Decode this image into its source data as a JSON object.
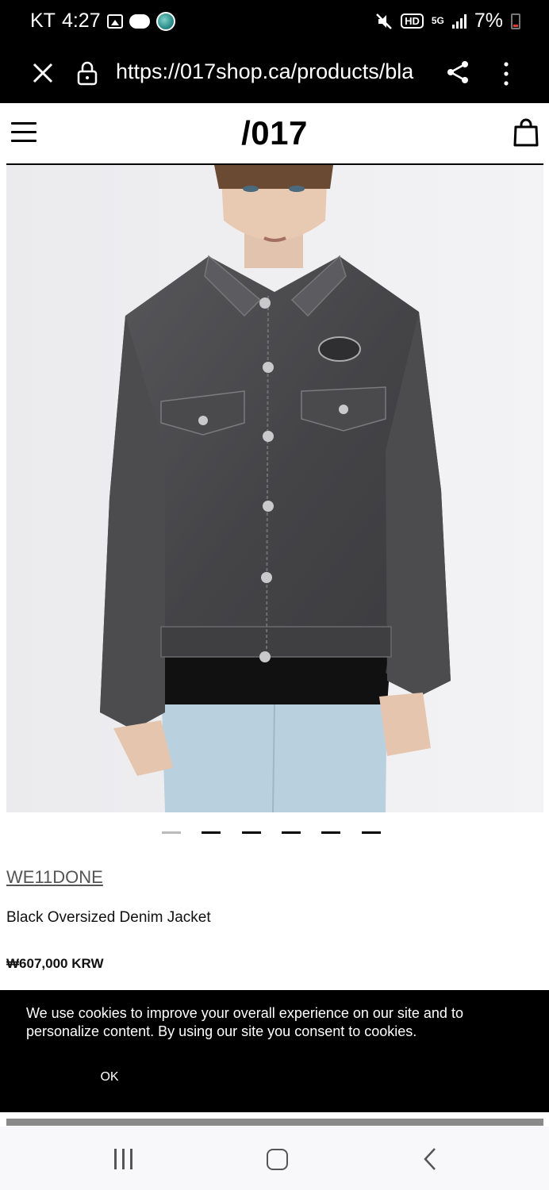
{
  "status_bar": {
    "carrier": "KT",
    "time": "4:27",
    "notification_icons": [
      "image-icon",
      "cloud-icon",
      "app-icon"
    ],
    "system_icons": [
      "mute-icon",
      "hd-icon",
      "5g-icon",
      "signal-icon"
    ],
    "hd_label": "HD",
    "network_label": "5G",
    "battery_percent": "7%"
  },
  "browser": {
    "url": "https://017shop.ca/products/bla",
    "icons": [
      "close-icon",
      "lock-icon",
      "share-icon",
      "more-icon"
    ]
  },
  "site": {
    "logo": "/017",
    "icons": [
      "menu-icon",
      "shopping-bag-icon"
    ]
  },
  "product": {
    "image_alt": "Black Oversized Denim Jacket",
    "carousel": {
      "total": 6,
      "active_index": 0
    },
    "brand": "WE11DONE",
    "name": "Black Oversized Denim Jacket",
    "price": "₩607,000 KRW"
  },
  "cookie_banner": {
    "message": "We use cookies to improve your overall experience on our site and to personalize content. By using our site you consent to cookies.",
    "ok_label": "OK"
  },
  "nav_bar": {
    "icons": [
      "recent-apps-icon",
      "home-icon",
      "back-icon"
    ]
  },
  "colors": {
    "background": "#ffffff",
    "bars": "#000000",
    "image_bg": "#f0f0f2",
    "denim": "#4a4a4c",
    "jeans": "#b9d1de",
    "muted_text": "#555555"
  }
}
